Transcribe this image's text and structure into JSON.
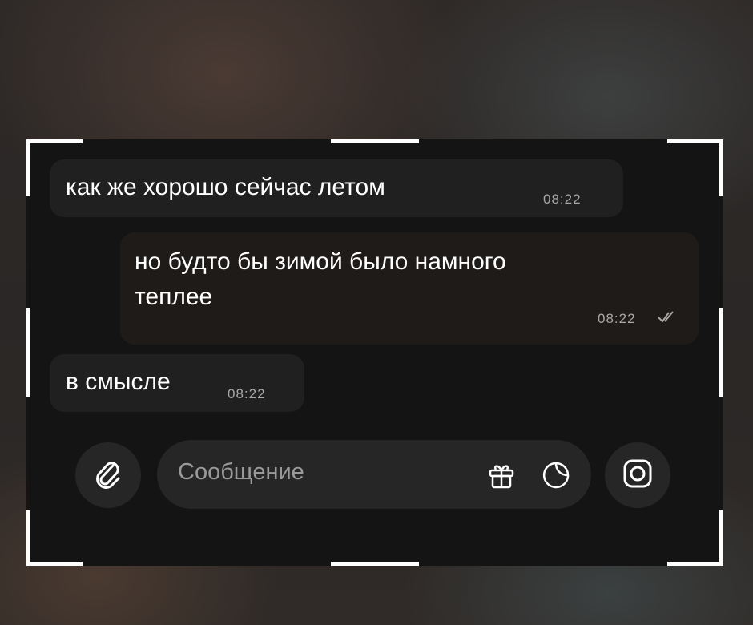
{
  "messages": [
    {
      "text": "как же хорошо сейчас летом",
      "time": "08:22",
      "direction": "incoming"
    },
    {
      "text_line1": "но будто бы зимой было намного",
      "text_line2": "теплее",
      "time": "08:22",
      "direction": "outgoing",
      "read": true
    },
    {
      "text": "в смысле",
      "time": "08:22",
      "direction": "incoming"
    }
  ],
  "composer": {
    "placeholder": "Сообщение",
    "icons": [
      "paperclip-icon",
      "gift-icon",
      "sticker-icon",
      "camera-icon"
    ]
  },
  "colors": {
    "frame_bg": "#141414",
    "bubble_bg": "#202020",
    "button_bg": "#262626",
    "text": "#ffffff",
    "timestamp": "#a8a8a8",
    "corner_marks": "#ffffff"
  }
}
